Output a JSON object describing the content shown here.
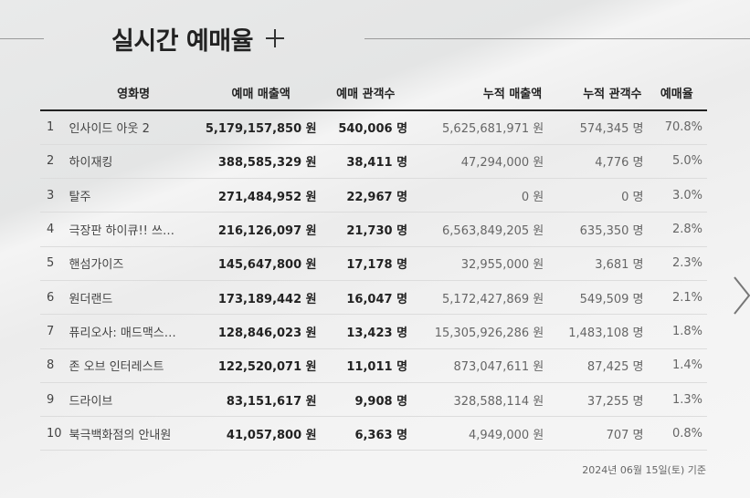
{
  "header": {
    "title": "실시간 예매율",
    "expand_icon": "plus-icon"
  },
  "table": {
    "columns": [
      "영화명",
      "예매 매출액",
      "예매 관객수",
      "누적 매출액",
      "누적 관객수",
      "예매율"
    ],
    "rows": [
      {
        "rank": "1",
        "title": "인사이드 아웃 2",
        "sales": "5,179,157,850 원",
        "audience": "540,006 명",
        "cum_sales": "5,625,681,971 원",
        "cum_audience": "574,345 명",
        "rate": "70.8%"
      },
      {
        "rank": "2",
        "title": "하이재킹",
        "sales": "388,585,329 원",
        "audience": "38,411 명",
        "cum_sales": "47,294,000 원",
        "cum_audience": "4,776 명",
        "rate": "5.0%"
      },
      {
        "rank": "3",
        "title": "탈주",
        "sales": "271,484,952 원",
        "audience": "22,967 명",
        "cum_sales": "0 원",
        "cum_audience": "0 명",
        "rate": "3.0%"
      },
      {
        "rank": "4",
        "title": "극장판 하이큐!! 쓰…",
        "sales": "216,126,097 원",
        "audience": "21,730 명",
        "cum_sales": "6,563,849,205 원",
        "cum_audience": "635,350 명",
        "rate": "2.8%"
      },
      {
        "rank": "5",
        "title": "핸섬가이즈",
        "sales": "145,647,800 원",
        "audience": "17,178 명",
        "cum_sales": "32,955,000 원",
        "cum_audience": "3,681 명",
        "rate": "2.3%"
      },
      {
        "rank": "6",
        "title": "원더랜드",
        "sales": "173,189,442 원",
        "audience": "16,047 명",
        "cum_sales": "5,172,427,869 원",
        "cum_audience": "549,509 명",
        "rate": "2.1%"
      },
      {
        "rank": "7",
        "title": "퓨리오사: 매드맥스…",
        "sales": "128,846,023 원",
        "audience": "13,423 명",
        "cum_sales": "15,305,926,286 원",
        "cum_audience": "1,483,108 명",
        "rate": "1.8%"
      },
      {
        "rank": "8",
        "title": "존 오브 인터레스트",
        "sales": "122,520,071 원",
        "audience": "11,011 명",
        "cum_sales": "873,047,611 원",
        "cum_audience": "87,425 명",
        "rate": "1.4%"
      },
      {
        "rank": "9",
        "title": "드라이브",
        "sales": "83,151,617 원",
        "audience": "9,908 명",
        "cum_sales": "328,588,114 원",
        "cum_audience": "37,255 명",
        "rate": "1.3%"
      },
      {
        "rank": "10",
        "title": "북극백화점의 안내원",
        "sales": "41,057,800 원",
        "audience": "6,363 명",
        "cum_sales": "4,949,000 원",
        "cum_audience": "707 명",
        "rate": "0.8%"
      }
    ]
  },
  "footer": {
    "note": "2024년 06월 15일(토) 기준"
  },
  "nav": {
    "next_icon": "chevron-right-icon"
  }
}
